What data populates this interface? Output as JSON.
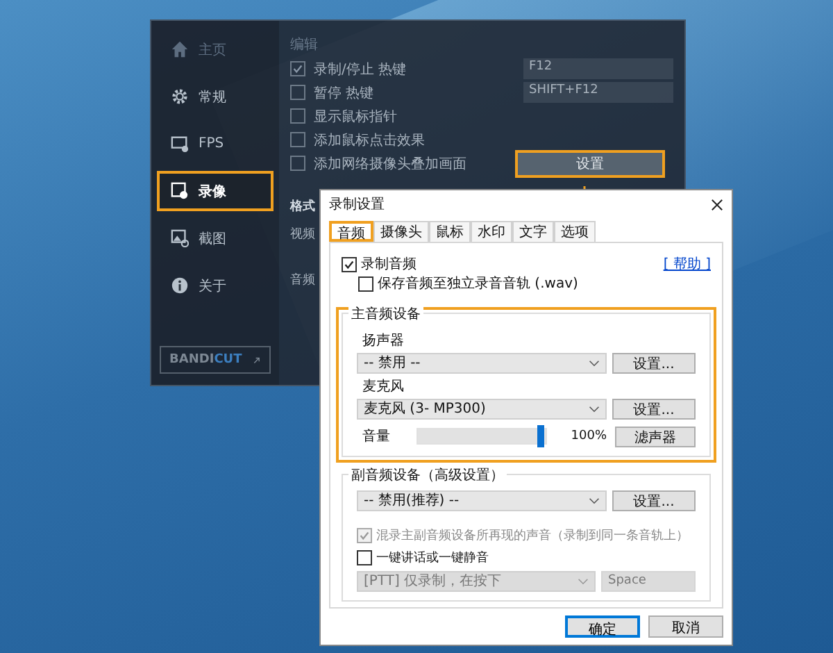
{
  "app": {
    "sidebar": [
      {
        "label": "主页",
        "selected": false,
        "faded": true
      },
      {
        "label": "常规",
        "selected": false,
        "faded": false
      },
      {
        "label": "FPS",
        "selected": false,
        "faded": false
      },
      {
        "label": "录像",
        "selected": true,
        "faded": false
      },
      {
        "label": "截图",
        "selected": false,
        "faded": false
      },
      {
        "label": "关于",
        "selected": false,
        "faded": false
      }
    ],
    "brand": {
      "first": "BANDI",
      "second": "CUT"
    },
    "section_title": "编辑",
    "options": [
      {
        "label": "录制/停止 热键",
        "checked": true,
        "hotkey": "F12"
      },
      {
        "label": "暂停 热键",
        "checked": false,
        "hotkey": "SHIFT+F12"
      },
      {
        "label": "显示鼠标指针",
        "checked": false
      },
      {
        "label": "添加鼠标点击效果",
        "checked": false
      },
      {
        "label": "添加网络摄像头叠加画面",
        "checked": false
      }
    ],
    "settings_button": {
      "label": "设置",
      "highlighted": true
    },
    "format_title": "格式",
    "format_rows": [
      "视频",
      "音频"
    ]
  },
  "dialog": {
    "title": "录制设置",
    "tabs": [
      {
        "label": "音频",
        "selected": true
      },
      {
        "label": "摄像头",
        "selected": false
      },
      {
        "label": "鼠标",
        "selected": false
      },
      {
        "label": "水印",
        "selected": false
      },
      {
        "label": "文字",
        "selected": false
      },
      {
        "label": "选项",
        "selected": false
      }
    ],
    "record_audio": {
      "label": "录制音频",
      "checked": true
    },
    "help_link": "[ 帮助 ]",
    "save_separate": {
      "label": "保存音频至独立录音音轨 (.wav)",
      "checked": false
    },
    "main_group": {
      "title": "主音频设备",
      "highlighted": true,
      "speaker_label": "扬声器",
      "speaker_value": "-- 禁用 --",
      "speaker_button": "设置...",
      "mic_label": "麦克风",
      "mic_value": "麦克风 (3- MP300)",
      "mic_button": "设置...",
      "volume_label": "音量",
      "volume": {
        "level": 1.0
      },
      "volume_reading": "100%",
      "filter_button": "滤声器"
    },
    "secondary_group": {
      "title": "副音频设备（高级设置）",
      "device_value": "-- 禁用(推荐) --",
      "device_button": "设置...",
      "mix": {
        "label": "混录主副音频设备所再现的声音（录制到同一条音轨上）",
        "checked": true,
        "disabled": true
      },
      "ptt": {
        "label": "一键讲话或一键静音",
        "checked": false,
        "disabled": false
      },
      "ptt_mode": {
        "value": "[PTT] 仅录制，在按下",
        "disabled": true
      },
      "ptt_key": {
        "value": "Space",
        "disabled": true
      }
    },
    "buttons": [
      {
        "label": "确定",
        "default": true
      },
      {
        "label": "取消",
        "default": false
      }
    ]
  }
}
